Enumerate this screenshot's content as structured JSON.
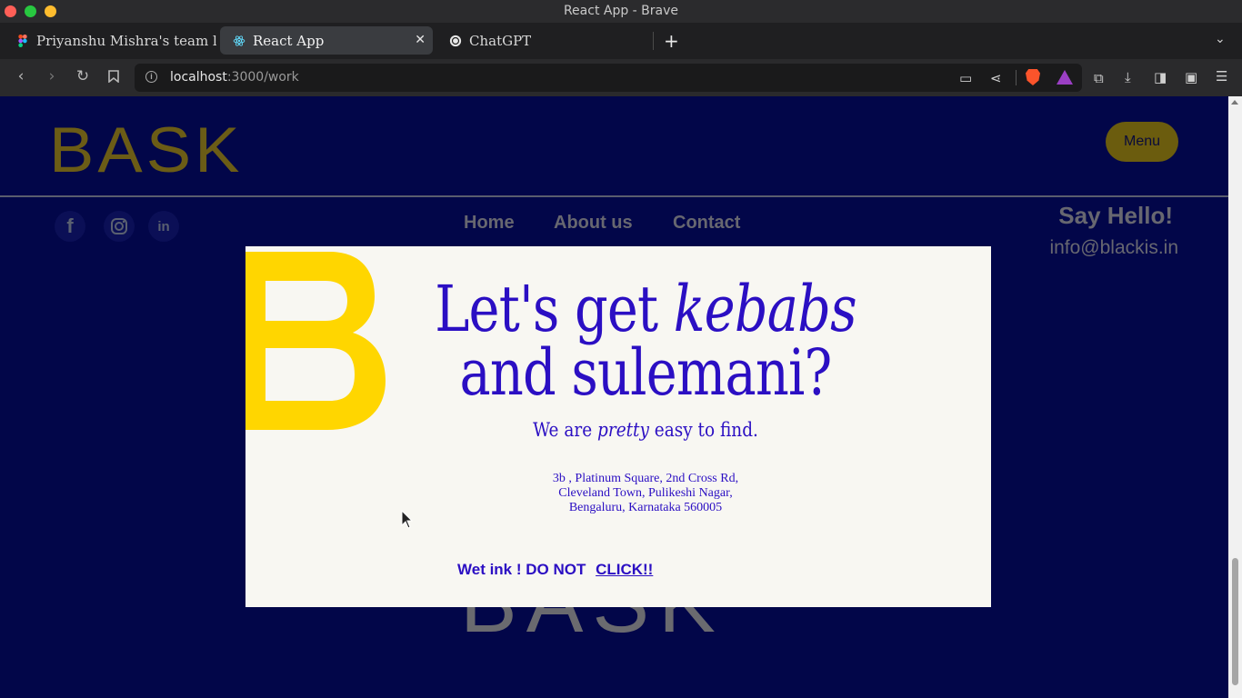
{
  "window": {
    "title": "React App - Brave"
  },
  "tabs": [
    {
      "label": "Priyanshu Mishra's team libr",
      "icon": "figma-icon",
      "active": false
    },
    {
      "label": "React App",
      "icon": "react-icon",
      "active": true
    },
    {
      "label": "ChatGPT",
      "icon": "chatgpt-icon",
      "active": false
    }
  ],
  "address_bar": {
    "host": "localhost",
    "path": ":3000/work"
  },
  "page": {
    "logo": "BASK",
    "menu_label": "Menu",
    "footer_nav": [
      "Home",
      "About us",
      "Contact"
    ],
    "say_hello": "Say Hello!",
    "email": "info@blackis.in",
    "footer_logo": "BASK",
    "social_icons": [
      "facebook-icon",
      "instagram-icon",
      "linkedin-icon"
    ],
    "colors": {
      "background": "#020649",
      "accent_yellow": "#ffd600",
      "brand_blue": "#2b0fc3",
      "card": "#f8f7f2"
    }
  },
  "modal": {
    "headline_line1_prefix": "Let's get ",
    "headline_line1_italic": "kebabs",
    "headline_line2": "and sulemani?",
    "sub_prefix": "We are ",
    "sub_italic": "pretty",
    "sub_suffix": " easy to find.",
    "address_lines": [
      "3b , Platinum Square, 2nd Cross Rd,",
      "Cleveland Town, Pulikeshi Nagar,",
      "Bengaluru, Karnataka 560005"
    ],
    "wet_ink_text": "Wet ink ! DO NOT ",
    "wet_ink_link": "CLICK!!"
  }
}
